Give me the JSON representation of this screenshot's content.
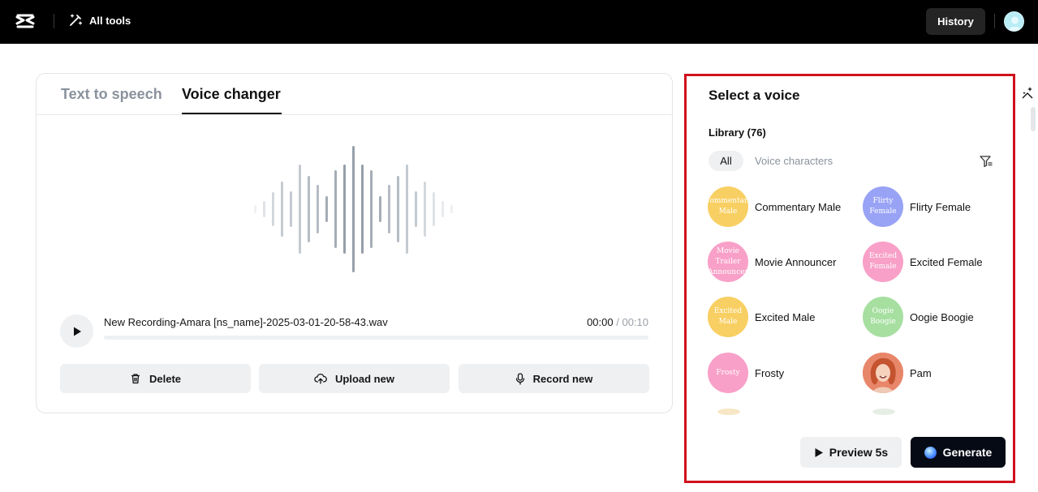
{
  "topbar": {
    "all_tools_label": "All tools",
    "history_label": "History"
  },
  "tabs": [
    {
      "label": "Text to speech",
      "active": false
    },
    {
      "label": "Voice changer",
      "active": true
    }
  ],
  "player": {
    "filename": "New Recording-Amara [ns_name]-2025-03-01-20-58-43.wav",
    "current_time": "00:00",
    "total_time": " / 00:10",
    "progress": 0
  },
  "actions": {
    "delete_label": "Delete",
    "upload_label": "Upload new",
    "record_label": "Record new"
  },
  "panel": {
    "title": "Select a voice",
    "library_label": "Library (76)",
    "filter_all": "All",
    "filter_characters": "Voice characters",
    "voices": [
      {
        "name": "Commentary Male",
        "avatar_text": "Commentary Male",
        "color": "#f8cf62"
      },
      {
        "name": "Flirty Female",
        "avatar_text": "Flirty Female",
        "color": "#98a3f5"
      },
      {
        "name": "Movie Announcer",
        "avatar_text": "Movie Trailer Announcer",
        "color": "#f8a0c8"
      },
      {
        "name": "Excited Female",
        "avatar_text": "Excited Female",
        "color": "#f8a0c8"
      },
      {
        "name": "Excited Male",
        "avatar_text": "Excited Male",
        "color": "#f8cf62"
      },
      {
        "name": "Oogie Boogie",
        "avatar_text": "Oogie Boogie",
        "color": "#a6dfa0"
      },
      {
        "name": "Frosty",
        "avatar_text": "Frosty",
        "color": "#f8a0c8"
      },
      {
        "name": "Pam",
        "avatar_text": "",
        "color": "#e8866a"
      }
    ],
    "preview_label": "Preview 5s",
    "generate_label": "Generate"
  },
  "colors": {
    "accent_border": "#d0111c",
    "topbar_bg": "#000000",
    "button_bg": "#eef0f2",
    "generate_bg": "#050a14"
  }
}
